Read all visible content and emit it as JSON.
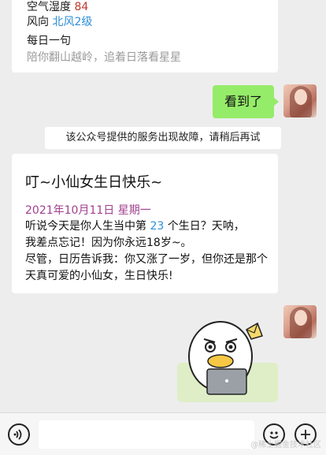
{
  "weather_card": {
    "humidity_label": "空气湿度",
    "humidity_value": "84",
    "wind_label": "风向",
    "wind_value": "北风2级",
    "daily_title": "每日一句",
    "daily_quote": "陪你翻山越岭，追着日落看星星"
  },
  "outgoing_message": "看到了",
  "system_notice": "该公众号提供的服务出现故障，请稍后再试",
  "birthday_card": {
    "title": "叮~小仙女生日快乐~",
    "date": "2021年10月11日 星期一",
    "line1_prefix": "听说今天是你人生当中第",
    "birthday_count": "23",
    "line1_suffix": "个生日？天呐，",
    "line2": "我差点忘记！因为你永远18岁~。",
    "line3": "尽管，日历告诉我：你又涨了一岁，但你还是那个天真可爱的小仙女，生日快乐!"
  },
  "toolbar": {
    "watermark": "@稀土掘金技术社区"
  },
  "colors": {
    "bubble_green": "#95ec69",
    "humidity_value": "#c0392b",
    "wind_value": "#2f8fd6",
    "date_purple": "#a0408f"
  }
}
